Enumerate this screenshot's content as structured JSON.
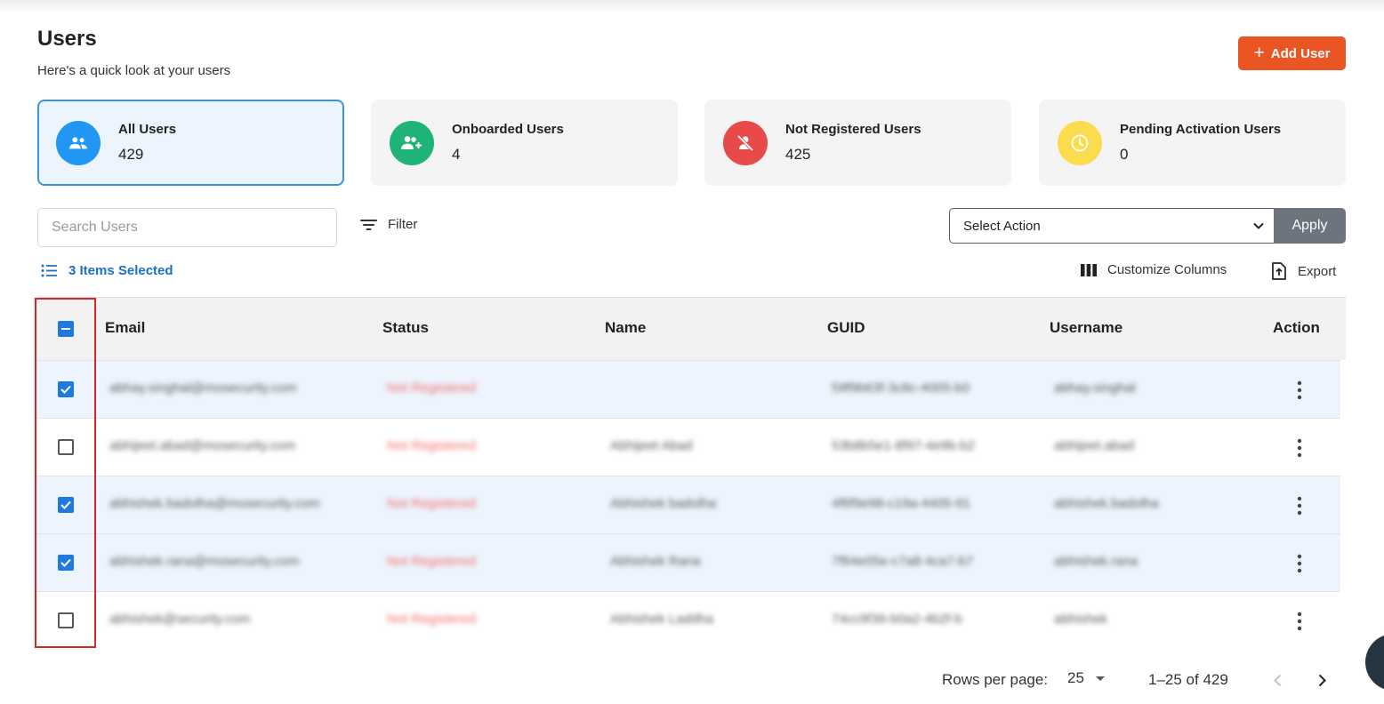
{
  "header": {
    "title": "Users",
    "subtitle": "Here's a quick look at your users",
    "add_user_label": "Add User"
  },
  "stats": [
    {
      "label": "All Users",
      "count": "429",
      "icon": "users-icon",
      "color": "#2196f3"
    },
    {
      "label": "Onboarded Users",
      "count": "4",
      "icon": "user-add-icon",
      "color": "#1fb377"
    },
    {
      "label": "Not Registered Users",
      "count": "425",
      "icon": "user-off-icon",
      "color": "#e84a4a"
    },
    {
      "label": "Pending Activation Users",
      "count": "0",
      "icon": "clock-icon",
      "color": "#fbdc4f"
    }
  ],
  "toolbar": {
    "search_placeholder": "Search Users",
    "filter_label": "Filter",
    "select_action_label": "Select Action",
    "apply_label": "Apply",
    "selected_label": "3 Items Selected",
    "customize_label": "Customize Columns",
    "export_label": "Export"
  },
  "table": {
    "columns": [
      "Email",
      "Status",
      "Name",
      "GUID",
      "Username",
      "Action"
    ],
    "rows": [
      {
        "selected": true,
        "email": "abhay.singhal@mosecurity.com",
        "status": "Not Registered",
        "name": "",
        "guid": "59f9b63f-3c8c-4005-b0",
        "username": "abhay.singhal"
      },
      {
        "selected": false,
        "email": "abhijeet.abad@mosecurity.com",
        "status": "Not Registered",
        "name": "Abhijeet Abad",
        "guid": "53b8b5e1-8f97-4e9b-b2",
        "username": "abhijeet.abad"
      },
      {
        "selected": true,
        "email": "abhishek.badolha@mosecurity.com",
        "status": "Not Registered",
        "name": "Abhishek badolha",
        "guid": "4f6f9e98-c19a-4405-91",
        "username": "abhishek.badolha"
      },
      {
        "selected": true,
        "email": "abhishek.rana@mosecurity.com",
        "status": "Not Registered",
        "name": "Abhishek Rana",
        "guid": "7f64e05e-c7a8-4ca7-b7",
        "username": "abhishek.rana"
      },
      {
        "selected": false,
        "email": "abhishek@security.com",
        "status": "Not Registered",
        "name": "Abhishek Laddha",
        "guid": "74cc9f39-b0a2-4b2f-b",
        "username": "abhishek"
      }
    ]
  },
  "pagination": {
    "rows_per_page_label": "Rows per page:",
    "rows_per_page_value": "25",
    "range_label": "1–25 of 429"
  }
}
